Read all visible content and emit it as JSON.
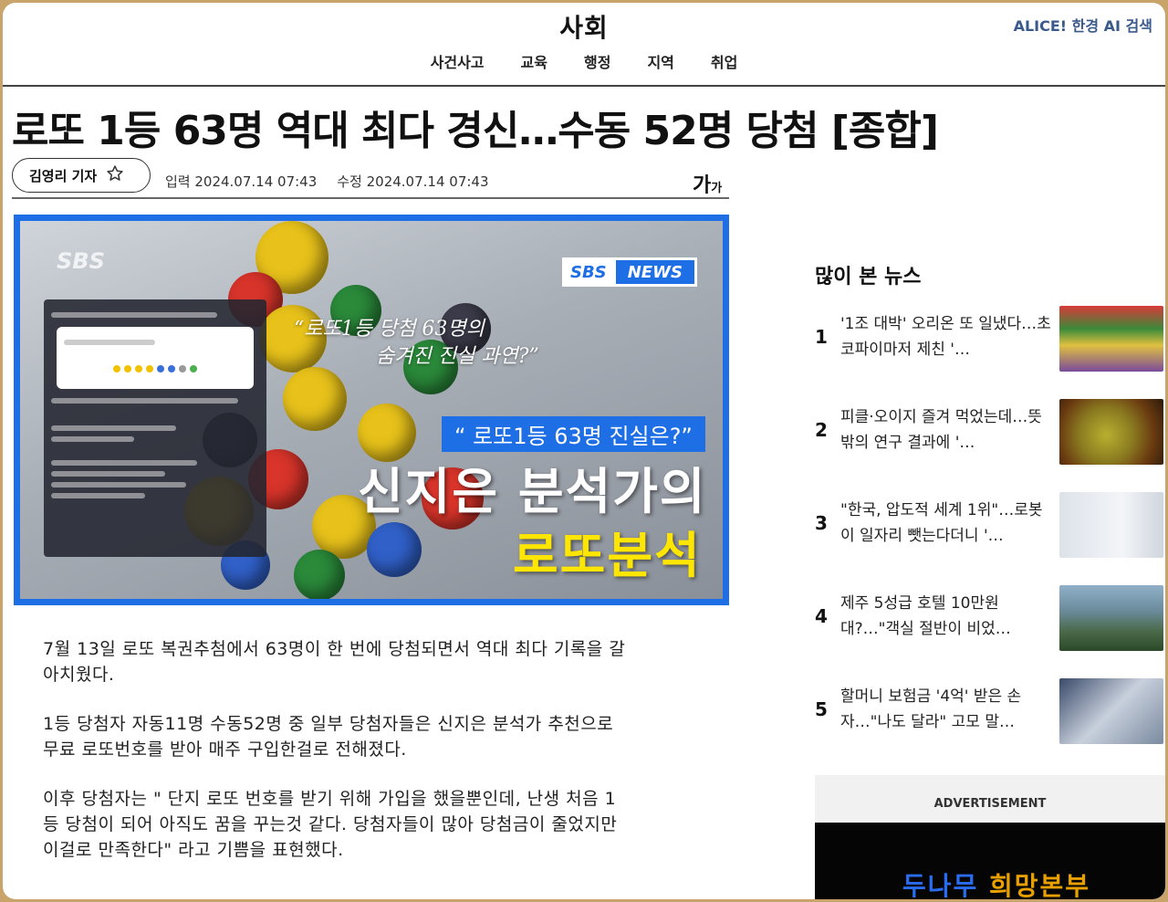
{
  "header": {
    "section_title": "사회",
    "alice": "ALICE! 한경 AI 검색",
    "subnav": [
      "사건사고",
      "교육",
      "행정",
      "지역",
      "취업"
    ]
  },
  "article": {
    "headline": "로또 1등 63명 역대 최다 경신…수동 52명 당첨 [종합]",
    "reporter": "김영리 기자",
    "input_date": "입력 2024.07.14 07:43",
    "modify_date": "수정 2024.07.14 07:43",
    "font_size_label": "가",
    "font_size_small": "가",
    "image": {
      "sbs_logo": "SBS",
      "sbs_news_a": "SBS",
      "sbs_news_b": "NEWS",
      "quote_line1": "“로또1등 당첨 63명의",
      "quote_line2": "숨겨진 진실 과연?”",
      "blue_caption": "“ 로또1등 63명 진실은?”",
      "big_white": "신지은 분석가의",
      "big_yellow": "로또분석"
    },
    "paragraphs": [
      "7월 13일 로또 복권추첨에서 63명이 한 번에 당첨되면서 역대 최다 기록을 갈아치웠다.",
      "1등 당첨자 자동11명 수동52명 중 일부 당첨자들은 신지은 분석가 추천으로 무료 로또번호를 받아 매주 구입한걸로 전해졌다.",
      "이후 당첨자는 \" 단지 로또 번호를 받기 위해 가입을 했을뿐인데, 난생 처음 1등 당첨이 되어 아직도 꿈을 꾸는것 같다. 당첨자들이 많아 당첨금이 줄었지만 이걸로 만족한다\" 라고 기쁨을 표현했다."
    ]
  },
  "popular": {
    "title": "많이 본 뉴스",
    "items": [
      {
        "rank": "1",
        "text": "'1조 대박' 오리온 또 일냈다…초코파이마저 제친 '…"
      },
      {
        "rank": "2",
        "text": "피클·오이지 즐겨 먹었는데…뜻밖의 연구 결과에 '…"
      },
      {
        "rank": "3",
        "text": "\"한국, 압도적 세계 1위\"…로봇이 일자리 뺏는다더니 '…"
      },
      {
        "rank": "4",
        "text": "제주 5성급 호텔 10만원대?…\"객실 절반이 비었…"
      },
      {
        "rank": "5",
        "text": "할머니 보험금 '4억' 받은 손자…\"나도 달라\" 고모 말…"
      }
    ]
  },
  "ad": {
    "label": "ADVERTISEMENT",
    "brand_a": "두나무",
    "brand_b": "희망본부"
  }
}
